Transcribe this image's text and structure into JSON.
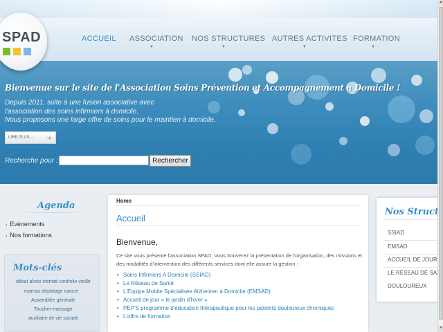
{
  "logo": {
    "text": "SPAD"
  },
  "nav": {
    "items": [
      {
        "label": "ACCUEIL",
        "active": true
      },
      {
        "label": "ASSOCIATION",
        "has_submenu": true
      },
      {
        "label": "NOS STRUCTURES",
        "has_submenu": true
      },
      {
        "label": "AUTRES ACTIVITES",
        "has_submenu": true
      },
      {
        "label": "FORMATION",
        "has_submenu": true
      }
    ],
    "caret": "▼"
  },
  "hero": {
    "title": "Bienvenue sur le site de l'Association Soins Prévention et Accompagnement à Domicile !",
    "lines": [
      "Depuis 2011, suite à une fusion associative avec",
      "l'association des soins infirmiers à domicile.",
      "Nous proposons une large offre de soins pour le maintien à domicile."
    ],
    "read_more": "LIRE PLUS ...",
    "read_more_arrow": "➜",
    "search_label": "Recherche pour :",
    "search_value": "",
    "search_button": "Rechercher"
  },
  "agenda": {
    "title": "Agenda",
    "items": [
      "Evènements",
      "Nos formations"
    ]
  },
  "tags": {
    "title": "Mots-clés",
    "rows": [
      "débat aînés intimité cinéfolie vieillir",
      "marnaz dépistage cancer",
      "Assemblée générale",
      "Toucher-massage",
      "auxiliaire de vie sociale"
    ]
  },
  "main": {
    "breadcrumb": "Home",
    "page_title": "Accueil",
    "welcome": "Bienvenue,",
    "intro": "Ce site vous présente l'association SPAD. Vous trouverez la présentation de l'organisation, des missions et des modalités d'intervention des différents services dont elle assure la gestion :",
    "links": [
      "Soins Infirmiers A Domicile (SSIAD)",
      "Le Réseau de Santé",
      "L'Equipe Mobile Spécialisée Alzheimer à Domicile (EMSAD)",
      "Accueil de jour « le jardin d'hiver »",
      "PEP'S programme d'éducation thérapeutique pour les patients douloureux chroniques",
      "L'offre de formation"
    ]
  },
  "structures": {
    "title": "Nos Structures",
    "items": [
      "SSIAD",
      "EMSAD",
      "ACCUEIL DE JOUR",
      "LE RÉSEAU DE SANTÉ",
      "DOULOUREUX"
    ]
  },
  "scrollbar": {
    "up": "▲",
    "down": "▼"
  },
  "colors": {
    "accent": "#3a8fc8",
    "hero_blue": "#3e8dbd",
    "logo_green": "#7cbd2b",
    "logo_yellow": "#f2c230",
    "logo_blue": "#7ab7e6"
  }
}
